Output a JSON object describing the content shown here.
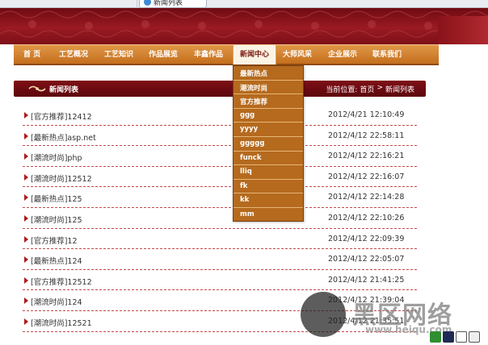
{
  "browser": {
    "tab_title": "新闻列表"
  },
  "nav": {
    "items": [
      {
        "label": "首 页"
      },
      {
        "label": "工艺概况"
      },
      {
        "label": "工艺知识"
      },
      {
        "label": "作品展览"
      },
      {
        "label": "丰鑫作品"
      },
      {
        "label": "新闻中心"
      },
      {
        "label": "大师风采"
      },
      {
        "label": "企业展示"
      },
      {
        "label": "联系我们"
      }
    ],
    "active": "新闻中心"
  },
  "dropdown": {
    "items": [
      {
        "label": "最新热点"
      },
      {
        "label": "潮流时尚"
      },
      {
        "label": "官方推荐"
      },
      {
        "label": "ggg"
      },
      {
        "label": "yyyy"
      },
      {
        "label": "ggggg"
      },
      {
        "label": "funck"
      },
      {
        "label": "lliq"
      },
      {
        "label": "fk"
      },
      {
        "label": "kk"
      },
      {
        "label": "mm"
      }
    ]
  },
  "title_bar": {
    "title": "新闻列表",
    "breadcrumb_prefix": "当前位置:",
    "breadcrumb_home": "首页",
    "breadcrumb_sep": ">",
    "breadcrumb_current": "新闻列表"
  },
  "news": {
    "rows": [
      {
        "title": "[官方推荐]12412",
        "date": "2012/4/21 12:10:49"
      },
      {
        "title": "[最新热点]asp.net",
        "date": "2012/4/12 22:58:11"
      },
      {
        "title": "[潮流时尚]php",
        "date": "2012/4/12 22:16:21"
      },
      {
        "title": "[潮流时尚]12512",
        "date": "2012/4/12 22:16:07"
      },
      {
        "title": "[最新热点]125",
        "date": "2012/4/12 22:14:28"
      },
      {
        "title": "[潮流时尚]125",
        "date": "2012/4/12 22:10:26"
      },
      {
        "title": "[官方推荐]12",
        "date": "2012/4/12 22:09:39"
      },
      {
        "title": "[最新热点]124",
        "date": "2012/4/12 22:05:07"
      },
      {
        "title": "[官方推荐]12512",
        "date": "2012/4/12 21:41:25"
      },
      {
        "title": "[潮流时尚]124",
        "date": "2012/4/12 21:39:04"
      },
      {
        "title": "[潮流时尚]12521",
        "date": "2012/4/12 21:35:51"
      }
    ]
  },
  "watermark": {
    "brand": "黑区网络",
    "url": "www.heiqu.com"
  },
  "colors": {
    "banner_red": "#7d1018",
    "nav_orange": "#c46e1c",
    "dropdown_brown": "#b56a1e",
    "list_red": "#b01b1b"
  }
}
